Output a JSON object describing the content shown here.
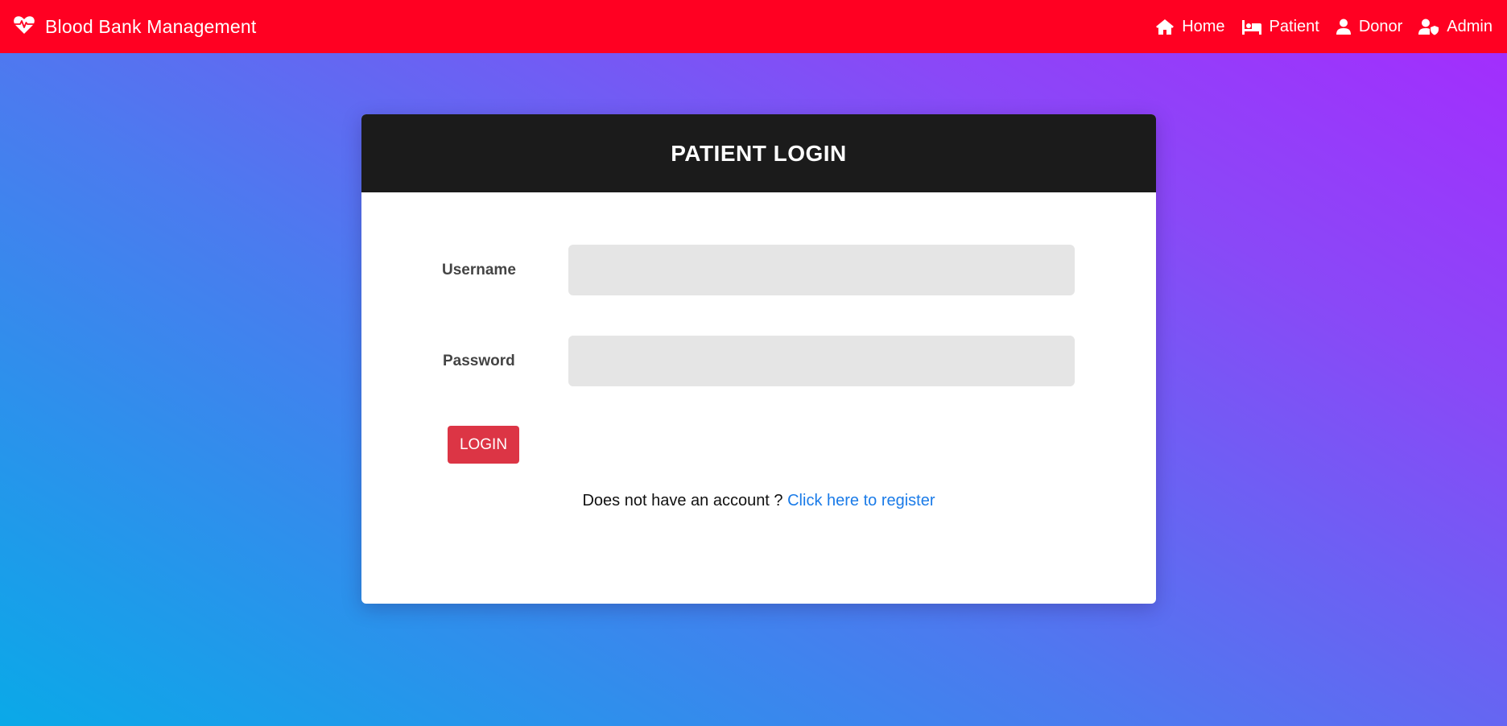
{
  "navbar": {
    "brand_icon": "heartbeat-icon",
    "brand_text": "Blood Bank Management",
    "bg_color": "#ff0022",
    "links": [
      {
        "label": "Home",
        "icon": "home-icon"
      },
      {
        "label": "Patient",
        "icon": "patient-bed-icon"
      },
      {
        "label": "Donor",
        "icon": "user-icon"
      },
      {
        "label": "Admin",
        "icon": "user-shield-icon"
      }
    ]
  },
  "login": {
    "title": "PATIENT LOGIN",
    "username_label": "Username",
    "username_value": "",
    "password_label": "Password",
    "password_value": "",
    "button_label": "LOGIN",
    "button_color": "#dc3545",
    "register_prompt": "Does not have an account ? ",
    "register_link": "Click here to register",
    "link_color": "#1a7be8"
  }
}
